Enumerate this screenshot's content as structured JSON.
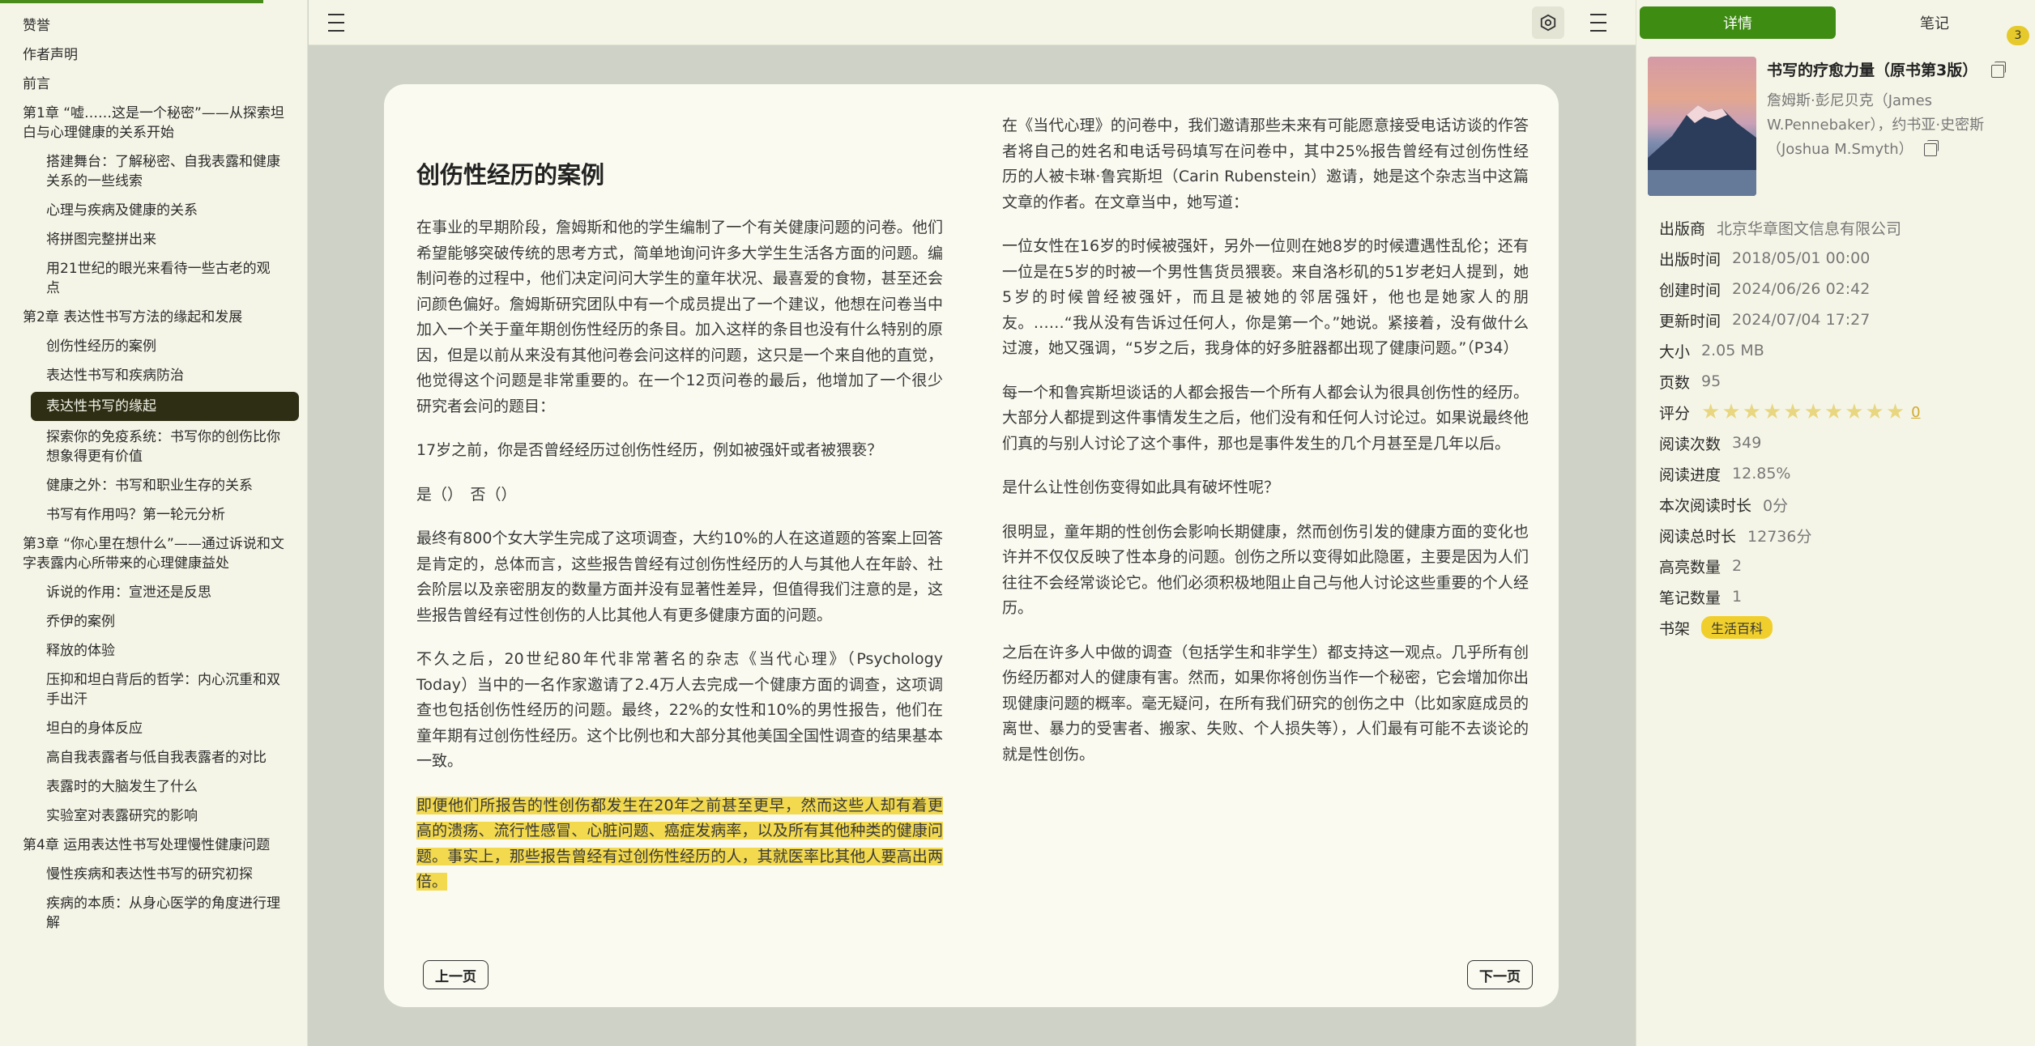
{
  "toc": [
    {
      "label": "赞誉",
      "level": 1
    },
    {
      "label": "作者声明",
      "level": 1
    },
    {
      "label": "前言",
      "level": 1
    },
    {
      "label": "第1章 “嘘……这是一个秘密”——从探索坦白与心理健康的关系开始",
      "level": 1
    },
    {
      "label": "搭建舞台：了解秘密、自我表露和健康关系的一些线索",
      "level": 2
    },
    {
      "label": "心理与疾病及健康的关系",
      "level": 2
    },
    {
      "label": "将拼图完整拼出来",
      "level": 2
    },
    {
      "label": "用21世纪的眼光来看待一些古老的观点",
      "level": 2
    },
    {
      "label": "第2章 表达性书写方法的缘起和发展",
      "level": 1
    },
    {
      "label": "创伤性经历的案例",
      "level": 2
    },
    {
      "label": "表达性书写和疾病防治",
      "level": 2
    },
    {
      "label": "表达性书写的缘起",
      "level": 2,
      "active": true
    },
    {
      "label": "探索你的免疫系统：书写你的创伤比你想象得更有价值",
      "level": 2
    },
    {
      "label": "健康之外：书写和职业生存的关系",
      "level": 2
    },
    {
      "label": "书写有作用吗？第一轮元分析",
      "level": 2
    },
    {
      "label": "第3章 “你心里在想什么”——通过诉说和文字表露内心所带来的心理健康益处",
      "level": 1
    },
    {
      "label": "诉说的作用：宣泄还是反思",
      "level": 2
    },
    {
      "label": "乔伊的案例",
      "level": 2
    },
    {
      "label": "释放的体验",
      "level": 2
    },
    {
      "label": "压抑和坦白背后的哲学：内心沉重和双手出汗",
      "level": 2
    },
    {
      "label": "坦白的身体反应",
      "level": 2
    },
    {
      "label": "高自我表露者与低自我表露者的对比",
      "level": 2
    },
    {
      "label": "表露时的大脑发生了什么",
      "level": 2
    },
    {
      "label": "实验室对表露研究的影响",
      "level": 2
    },
    {
      "label": "第4章 运用表达性书写处理慢性健康问题",
      "level": 1
    },
    {
      "label": "慢性疾病和表达性书写的研究初探",
      "level": 2
    },
    {
      "label": "疾病的本质：从身心医学的角度进行理解",
      "level": 2
    }
  ],
  "page": {
    "chapter_title": "创伤性经历的案例",
    "left_paragraphs": [
      "在事业的早期阶段，詹姆斯和他的学生编制了一个有关健康问题的问卷。他们希望能够突破传统的思考方式，简单地询问许多大学生生活各方面的问题。编制问卷的过程中，他们决定问问大学生的童年状况、最喜爱的食物，甚至还会问颜色偏好。詹姆斯研究团队中有一个成员提出了一个建议，他想在问卷当中加入一个关于童年期创伤性经历的条目。加入这样的条目也没有什么特别的原因，但是以前从来没有其他问卷会问这样的问题，这只是一个来自他的直觉，他觉得这个问题是非常重要的。在一个12页问卷的最后，他增加了一个很少研究者会问的题目：",
      "17岁之前，你是否曾经经历过创伤性经历，例如被强奸或者被猥亵？",
      "是（）　否（）",
      "最终有800个女大学生完成了这项调查，大约10%的人在这道题的答案上回答是肯定的，总体而言，这些报告曾经有过创伤性经历的人与其他人在年龄、社会阶层以及亲密朋友的数量方面并没有显著性差异，但值得我们注意的是，这些报告曾经有过性创伤的人比其他人有更多健康方面的问题。",
      "不久之后，20世纪80年代非常著名的杂志《当代心理》（Psychology Today）当中的一名作家邀请了2.4万人去完成一个健康方面的调查，这项调查也包括创伤性经历的问题。最终，22%的女性和10%的男性报告，他们在童年期有过创伤性经历。这个比例也和大部分其他美国全国性调查的结果基本一致。"
    ],
    "highlight_paragraph": "即便他们所报告的性创伤都发生在20年之前甚至更早，然而这些人却有着更高的溃疡、流行性感冒、心脏问题、癌症发病率，以及所有其他种类的健康问题。事实上，那些报告曾经有过创伤性经历的人，其就医率比其他人要高出两倍。",
    "right_paragraphs": [
      "在《当代心理》的问卷中，我们邀请那些未来有可能愿意接受电话访谈的作答者将自己的姓名和电话号码填写在问卷中，其中25%报告曾经有过创伤性经历的人被卡琳·鲁宾斯坦（Carin Rubenstein）邀请，她是这个杂志当中这篇文章的作者。在文章当中，她写道：",
      "一位女性在16岁的时候被强奸，另外一位则在她8岁的时候遭遇性乱伦；还有一位是在5岁的时被一个男性售货员猥亵。来自洛杉矶的51岁老妇人提到，她5岁的时候曾经被强奸，而且是被她的邻居强奸，他也是她家人的朋友。……“我从没有告诉过任何人，你是第一个。”她说。紧接着，没有做什么过渡，她又强调，“5岁之后，我身体的好多脏器都出现了健康问题。”（P34）",
      "每一个和鲁宾斯坦谈话的人都会报告一个所有人都会认为很具创伤性的经历。大部分人都提到这件事情发生之后，他们没有和任何人讨论过。如果说最终他们真的与别人讨论了这个事件，那也是事件发生的几个月甚至是几年以后。",
      "是什么让性创伤变得如此具有破坏性呢？",
      "很明显，童年期的性创伤会影响长期健康，然而创伤引发的健康方面的变化也许并不仅仅反映了性本身的问题。创伤之所以变得如此隐匿，主要是因为人们往往不会经常谈论它。他们必须积极地阻止自己与他人讨论这些重要的个人经历。",
      "之后在许多人中做的调查（包括学生和非学生）都支持这一观点。几乎所有创伤经历都对人的健康有害。然而，如果你将创伤当作一个秘密，它会增加你出现健康问题的概率。毫无疑问，在所有我们研究的创伤之中（比如家庭成员的离世、暴力的受害者、搬家、失败、个人损失等），人们最有可能不去谈论的就是性创伤。"
    ],
    "prev_label": "上一页",
    "next_label": "下一页"
  },
  "detail": {
    "tab_details": "详情",
    "tab_notes": "笔记",
    "notes_badge": "3",
    "title": "书写的疗愈力量（原书第3版）",
    "author": "詹姆斯·彭尼贝克（James W.Pennebaker），约书亚·史密斯（Joshua M.Smyth）",
    "meta": [
      {
        "k": "出版商",
        "v": "北京华章图文信息有限公司"
      },
      {
        "k": "出版时间",
        "v": "2018/05/01 00:00"
      },
      {
        "k": "创建时间",
        "v": "2024/06/26 02:42"
      },
      {
        "k": "更新时间",
        "v": "2024/07/04 17:27"
      },
      {
        "k": "大小",
        "v": "2.05 MB"
      },
      {
        "k": "页数",
        "v": "95"
      }
    ],
    "rating_label": "评分",
    "rating_value": "0",
    "rating_stars": 10,
    "meta2": [
      {
        "k": "阅读次数",
        "v": "349"
      },
      {
        "k": "阅读进度",
        "v": "12.85%"
      },
      {
        "k": "本次阅读时长",
        "v": "0分"
      },
      {
        "k": "阅读总时长",
        "v": "12736分"
      },
      {
        "k": "高亮数量",
        "v": "2"
      },
      {
        "k": "笔记数量",
        "v": "1"
      }
    ],
    "shelf_label": "书架",
    "shelf_tag": "生活百科"
  },
  "icons": {
    "menu": "hamburger-icon",
    "settings": "hexagon-settings-icon",
    "copy": "copy-icon",
    "star": "star-icon"
  },
  "colors": {
    "accent": "#3e8c12",
    "highlight": "#f2d94e",
    "active_toc": "#2e2e14",
    "tag": "#f0cf2c"
  }
}
